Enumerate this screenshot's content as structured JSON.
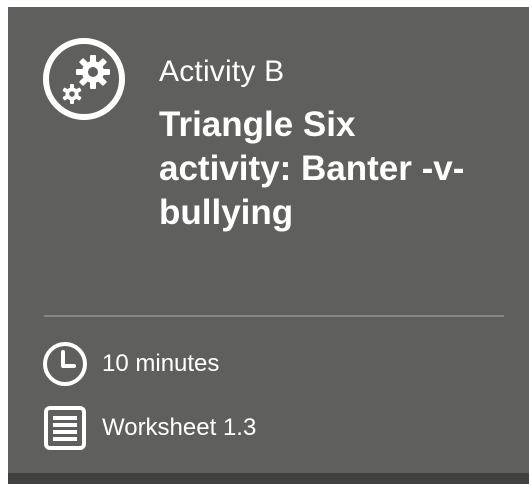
{
  "card": {
    "kicker": "Activity B",
    "title": "Triangle Six activity: Banter -v- bullying",
    "icon": "gears-icon"
  },
  "meta": {
    "duration": {
      "icon": "clock-icon",
      "text": "10 minutes"
    },
    "resource": {
      "icon": "document-icon",
      "text": "Worksheet 1.3"
    }
  },
  "colors": {
    "card_background": "#5f5f5d",
    "text": "#ffffff",
    "divider": "#858583",
    "bottom_strip": "#414140"
  }
}
